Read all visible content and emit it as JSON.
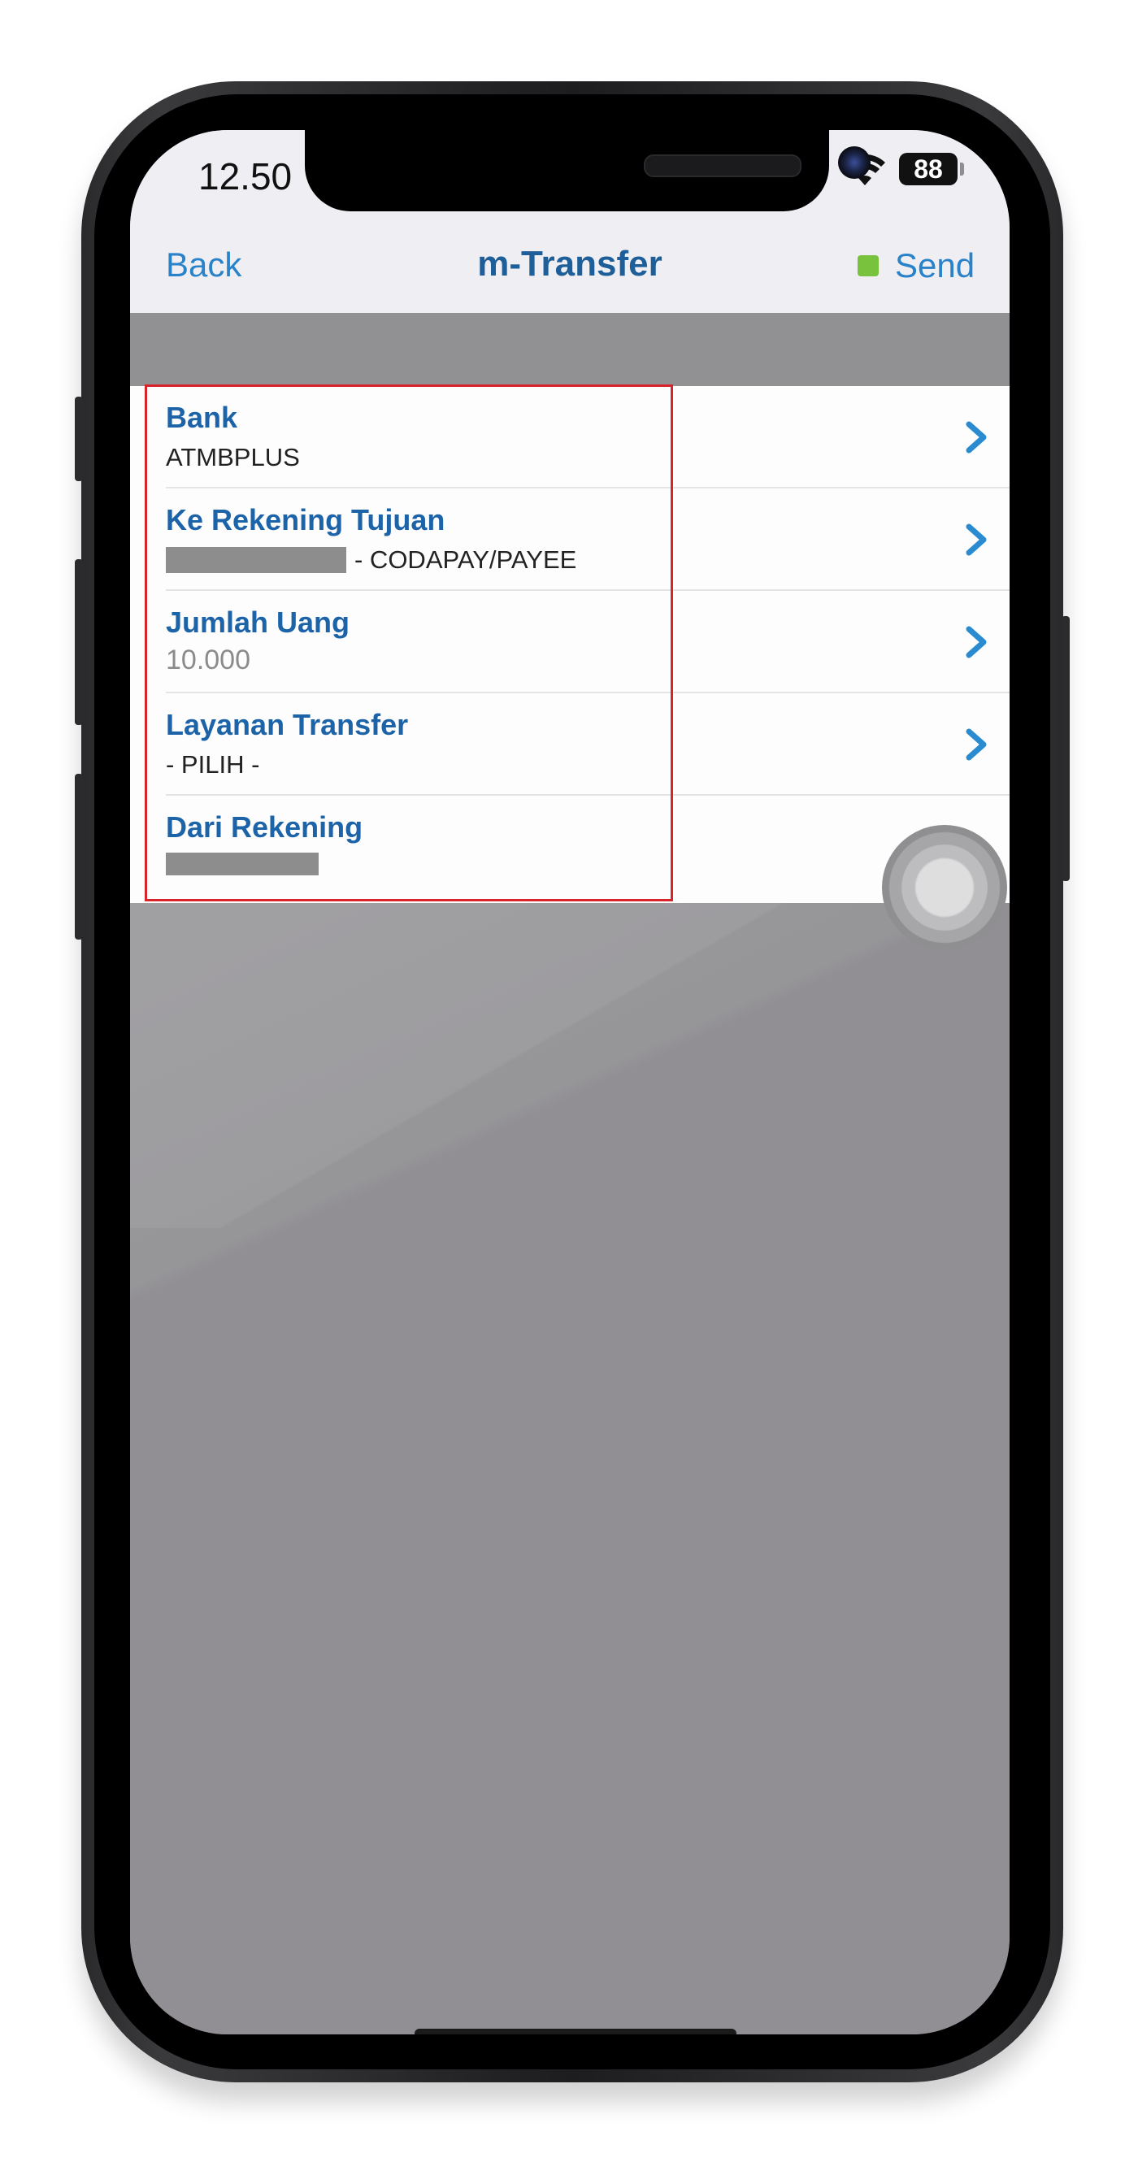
{
  "status_bar": {
    "time": "12.50",
    "battery": "88"
  },
  "nav": {
    "back_label": "Back",
    "title": "m-Transfer",
    "send_label": "Send",
    "send_dot_color": "#79c23e"
  },
  "form": {
    "rows": [
      {
        "title": "Bank",
        "value": "ATMBPLUS",
        "icon": "chevron-right-icon"
      },
      {
        "title": "Ke Rekening Tujuan",
        "value": "- CODAPAY/PAYEE",
        "icon": "chevron-right-icon"
      },
      {
        "title": "Jumlah Uang",
        "value": "10.000",
        "icon": "chevron-right-icon"
      },
      {
        "title": "Layanan Transfer",
        "value": "- PILIH -",
        "icon": "chevron-right-icon"
      },
      {
        "title": "Dari Rekening",
        "value": ""
      }
    ]
  },
  "colors": {
    "accent_blue": "#2a82c8",
    "title_blue": "#1d63a8",
    "highlight_red": "#d8232a"
  }
}
